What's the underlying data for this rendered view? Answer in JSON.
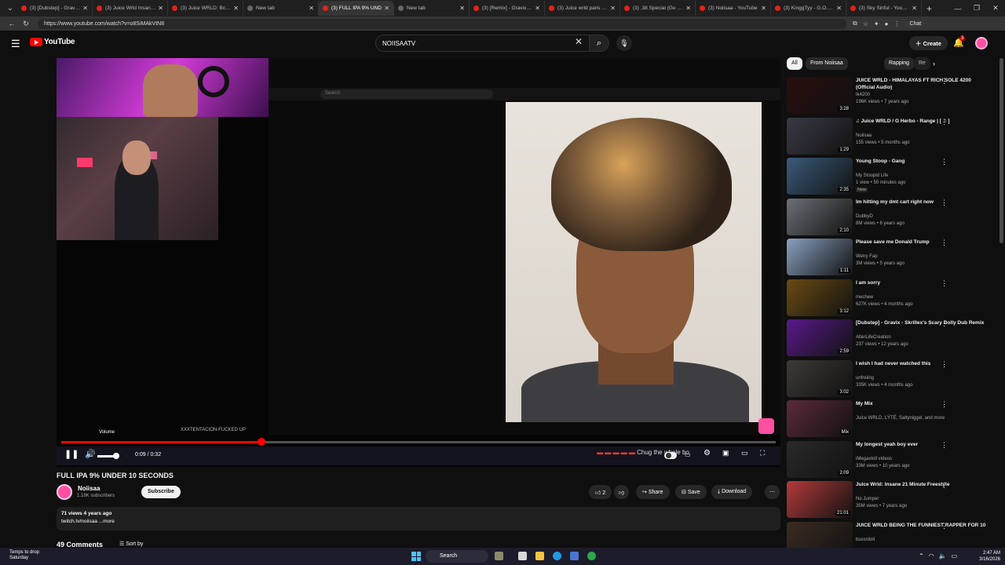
{
  "browser": {
    "tabs": [
      {
        "label": "(3) [Dubstep] - Gravix - S",
        "active": false
      },
      {
        "label": "(3) Juice Wrld Insane 21",
        "active": false
      },
      {
        "label": "(3) Juice WRLD: Bc Hero",
        "active": false
      },
      {
        "label": "New tab",
        "active": false
      },
      {
        "label": "(3) FULL IPA 9% UND",
        "active": true
      },
      {
        "label": "New tab",
        "active": false
      },
      {
        "label": "(3) [Remix] - Gravix - Cra",
        "active": false
      },
      {
        "label": "(3) Juice wrld paris freesty",
        "active": false
      },
      {
        "label": "(3) .38 Special (Go Go) -",
        "active": false
      },
      {
        "label": "(3) Noiisaa - YouTube",
        "active": false
      },
      {
        "label": "(3) KinggTyy - G.O.A.T",
        "active": false
      },
      {
        "label": "(3) Sky Sinful - YouTube",
        "active": false
      }
    ],
    "url": "https://www.youtube.com/watch?v=o8SiMAkVtN8",
    "chat_label": "Chat"
  },
  "header": {
    "logo_text": "YouTube",
    "search_value": "NOIISAATV",
    "create_label": "Create",
    "notification_count": "3"
  },
  "player": {
    "volume_label": "Volume",
    "time": "0:09 / 0:32",
    "progress": 0.28,
    "inner_title": "XXXTENTACION-FUCKED UP",
    "inner_search_placeholder": "Search",
    "overlay_text": "Chug the whole bo"
  },
  "video": {
    "title": "FULL IPA 9% UNDER 10 SECONDS",
    "channel": "Noiisaa",
    "subscribers": "1.18K subscribers",
    "subscribe_label": "Subscribe",
    "likes": "2",
    "share_label": "Share",
    "save_label": "Save",
    "download_label": "Download",
    "views_age": "71 views  4 years ago",
    "description_link": "twitch.tv/noiisaa ...more",
    "comments_label": "49 Comments",
    "sort_label": "Sort by"
  },
  "sidebar": {
    "chips": [
      "All",
      "From Noiisaa",
      "Rapping",
      "Re"
    ],
    "recommendations": [
      {
        "title": "JUICE WRLD - HIMALAYAS FT RICH SOLE 4200 (Official Audio)",
        "channel": "Ik4200",
        "meta": "196K views • 7 years ago",
        "duration": "3:28",
        "badge": "",
        "thumb": "#2a0d0d",
        "progress": 1.0
      },
      {
        "title": "♫ Juice WRLD / G Herbo - Range | [ ♫ ]",
        "channel": "Noiisaa",
        "meta": "155 views • 5 months ago",
        "duration": "1:29",
        "badge": "",
        "thumb": "#3a3a46",
        "progress": 0
      },
      {
        "title": "Young Stoop - Gang",
        "channel": "My Stoopid Life",
        "meta": "1 view • 50 minutes ago",
        "duration": "2:35",
        "badge": "New",
        "thumb": "#3b5b7a",
        "progress": 0
      },
      {
        "title": "Im hitting my dmt cart right now",
        "channel": "DubbyD",
        "meta": "8M views • 6 years ago",
        "duration": "2:10",
        "badge": "",
        "thumb": "#6b7176",
        "progress": 0
      },
      {
        "title": "Please save me Donald Trump",
        "channel": "Wetry Fap",
        "meta": "3M views • 5 years ago",
        "duration": "1:11",
        "badge": "",
        "thumb": "#8aa1c0",
        "progress": 0
      },
      {
        "title": "I am sorry",
        "channel": "mechew",
        "meta": "627K views • 4 months ago",
        "duration": "3:12",
        "badge": "",
        "thumb": "#6a4b12",
        "progress": 0
      },
      {
        "title": "[Dubstep] - Gravix - Skrillex's Scary Bolly Dub Remix",
        "channel": "AlterLifeCreation",
        "meta": "237 views • 12 years ago",
        "duration": "2:59",
        "badge": "",
        "thumb": "#5a1a8a",
        "progress": 0.8
      },
      {
        "title": "I wish I had never watched this",
        "channel": "unfreiing",
        "meta": "335K views • 4 months ago",
        "duration": "3:02",
        "badge": "",
        "thumb": "#3d3a36",
        "progress": 0
      },
      {
        "title": "My Mix",
        "channel": "Juice WRLD, LŸTË, Saltyniggel, and more",
        "meta": "",
        "duration": "Mix",
        "badge": "",
        "thumb": "#5c2a3a",
        "progress": 0
      },
      {
        "title": "My longest yeah boy ever",
        "channel": "iMegaxtoll videos",
        "meta": "33M views • 10 years ago",
        "duration": "2:09",
        "badge": "",
        "thumb": "#2a2a2a",
        "progress": 0
      },
      {
        "title": "Juice Wrld: Insane 21 Minute Freestyle",
        "channel": "No Jumper",
        "meta": "35M views • 7 years ago",
        "duration": "21:01",
        "badge": "",
        "thumb": "#b43a3a",
        "progress": 1.0
      },
      {
        "title": "JUICE WRLD BEING THE FUNNIEST RAPPER FOR 10",
        "channel": "bussrdoll",
        "meta": "",
        "duration": "",
        "badge": "",
        "thumb": "#3a2c22",
        "progress": 0
      }
    ]
  },
  "taskbar": {
    "weather_line1": "Temps to drop",
    "weather_line2": "Saturday",
    "search_label": "Search",
    "time": "2:47 AM",
    "date": "3/16/2026"
  }
}
